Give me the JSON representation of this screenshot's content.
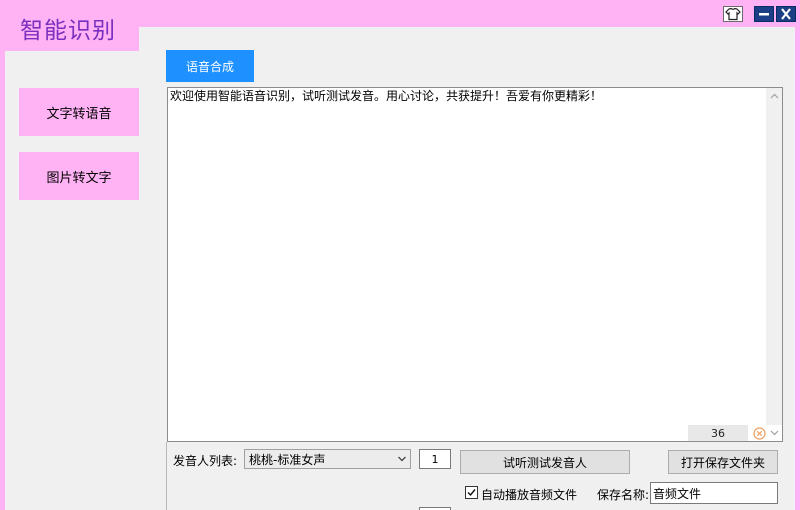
{
  "app": {
    "title": "智能识别"
  },
  "window_controls": {
    "skin_icon": "shirt-icon",
    "minimize_icon": "minimize-icon",
    "close_icon": "close-icon"
  },
  "sidebar": {
    "items": [
      {
        "label": "文字转语音"
      },
      {
        "label": "图片转文字"
      }
    ]
  },
  "tabs": [
    {
      "label": "语音合成",
      "active": true
    }
  ],
  "editor": {
    "text": "欢迎使用智能语音识别，试听测试发音。用心讨论，共获提升！吾爱有你更精彩！",
    "char_count": "36"
  },
  "voice": {
    "label": "发音人列表:",
    "selected": "桃桃-标准女声",
    "spin_value": "1",
    "test_button": "试听测试发音人",
    "open_folder_button": "打开保存文件夹"
  },
  "options": {
    "auto_play_label": "自动播放音频文件",
    "auto_play_checked": true,
    "save_name_label": "保存名称:",
    "save_name_value": "音频文件"
  },
  "colors": {
    "accent_pink": "#ffb3f5",
    "tab_blue": "#1e90ff",
    "title_purple": "#7a2fbf",
    "control_blue": "#1b3f86"
  }
}
